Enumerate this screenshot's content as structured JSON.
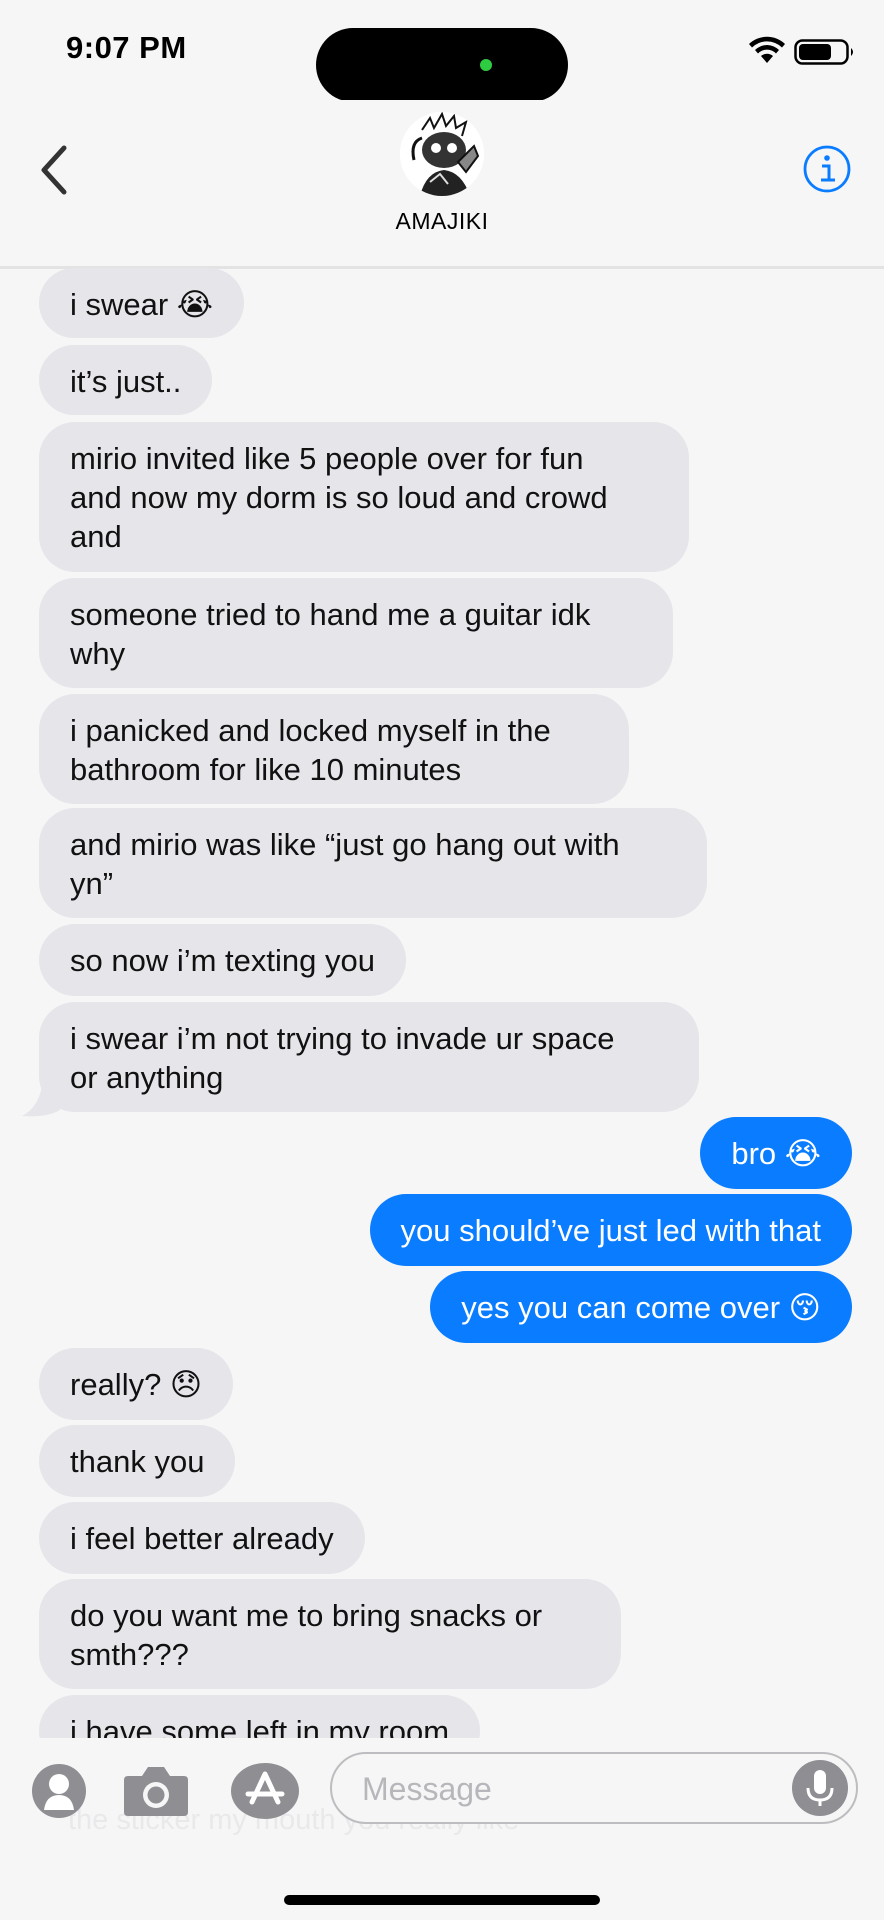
{
  "status_bar": {
    "time": "9:07 PM"
  },
  "header": {
    "contact_name": "AMAJIKI"
  },
  "messages": [
    {
      "side": "in",
      "text": "i swear 😭"
    },
    {
      "side": "in",
      "text": "it’s just.."
    },
    {
      "side": "in",
      "lines": [
        "mirio invited like 5 people over for fun",
        "and now my dorm is so loud and crowd",
        "and"
      ]
    },
    {
      "side": "in",
      "lines": [
        "someone tried to hand me a guitar idk",
        "why"
      ]
    },
    {
      "side": "in",
      "lines": [
        "i panicked and locked myself in the",
        "bathroom for like 10 minutes"
      ]
    },
    {
      "side": "in",
      "lines": [
        "and mirio was like “just go hang out with",
        "yn”"
      ]
    },
    {
      "side": "in",
      "text": "so now i’m texting you"
    },
    {
      "side": "in",
      "lines": [
        "i swear i’m not trying to invade ur space",
        "or anything"
      ]
    },
    {
      "side": "out",
      "text": "bro 😭"
    },
    {
      "side": "out",
      "text": "you should’ve just led with that"
    },
    {
      "side": "out",
      "text": "yes you can come over 😚"
    },
    {
      "side": "in",
      "text": "really? 😞"
    },
    {
      "side": "in",
      "text": "thank you"
    },
    {
      "side": "in",
      "text": "i feel better already"
    },
    {
      "side": "in",
      "lines": [
        "do you want me to bring snacks or",
        "smth???"
      ]
    },
    {
      "side": "in",
      "text": "i have some left in my room"
    }
  ],
  "composer": {
    "placeholder": "Message",
    "ghost_text": "the sticker my mouth you really like"
  },
  "icons": {
    "back": "chevron-left-icon",
    "info": "info-icon",
    "contacts": "person-circle-icon",
    "camera": "camera-icon",
    "apps": "app-store-icon",
    "mic": "microphone-icon"
  },
  "colors": {
    "outgoing": "#0a7cff",
    "incoming": "#e5e5ea",
    "accent": "#0a7cff"
  }
}
